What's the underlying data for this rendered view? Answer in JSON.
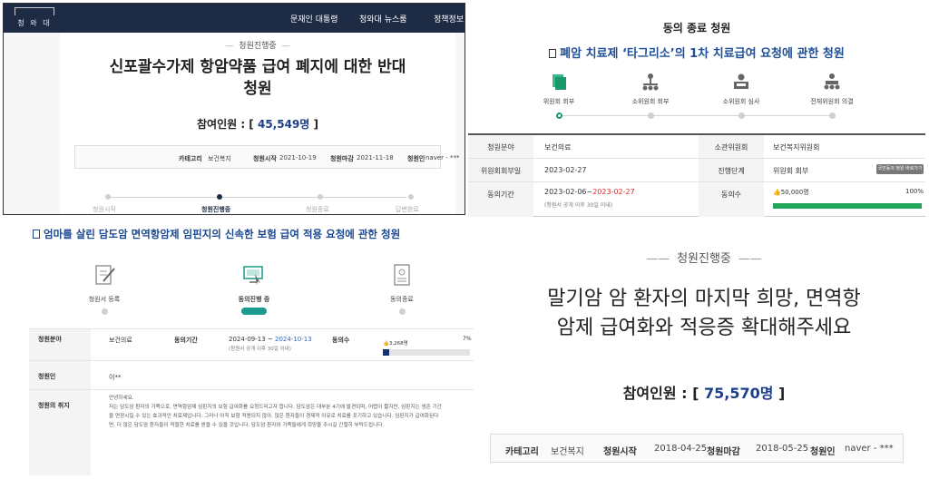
{
  "panel_a": {
    "logo_text": "청 와 대",
    "nav": [
      "문재인 대통령",
      "청와대 뉴스룸",
      "정책정보"
    ],
    "status": "청원진행중",
    "title_line1": "신포괄수가제 항암약품 급여 폐지에 대한 반대",
    "title_line2": "청원",
    "count_label": "참여인원 : [",
    "count_value": "45,549명",
    "count_close": "]",
    "info": {
      "category_label": "카테고리",
      "category_value": "보건복지",
      "start_label": "청원시작",
      "start_value": "2021-10-19",
      "end_label": "청원마감",
      "end_value": "2021-11-18",
      "author_label": "청원인",
      "author_value": "naver - ***"
    },
    "progress": [
      "청원시작",
      "청원진행중",
      "청원종료",
      "답변완료"
    ],
    "progress_active": 1
  },
  "panel_b": {
    "closed_label": "동의 종료 청원",
    "title": "폐암 치료제 ‘타그리소’의 1차 치료급여 요청에 관한 청원",
    "steps": [
      "위원회 회부",
      "소위원회 회부",
      "소위원회 심사",
      "전체위원회 의결"
    ],
    "steps_active": 0,
    "rows": {
      "field_label": "청원분야",
      "field_value": "보건의료",
      "committee_label": "소관위원회",
      "committee_value": "보건복지위원회",
      "refer_date_label": "위원회회부일",
      "refer_date_value": "2023-02-27",
      "stage_label": "진행단계",
      "stage_value": "위원회 회부",
      "more_button": "국민동의 청원 바로가기 >",
      "period_label": "동의기간",
      "period_start": "2023-02-06~",
      "period_end": "2023-02-27",
      "period_note": "(청원서 공개 이후 30일 이내)",
      "agree_label": "동의수",
      "agree_count": "50,000명",
      "agree_percent_label": "100%",
      "agree_fraction": 1.0
    },
    "colors": {
      "title": "#1d4f9a",
      "bar": "#21a55a",
      "deadline": "#d62b2b"
    }
  },
  "panel_c": {
    "title": "엄마를 살린 담도암 면역항암제 임핀지의 신속한 보험 급여 적용 요청에 관한 청원",
    "steps": [
      "청원서 등록",
      "동의진행 중",
      "동의종료"
    ],
    "steps_active": 1,
    "rows": {
      "field_label": "청원분야",
      "field_value": "보건의료",
      "period_label": "동의기간",
      "period_start": "2024-09-13 ~",
      "period_end": "2024-10-13",
      "period_note": "(청원서 공개 이후 30일 이내)",
      "agree_label": "동의수",
      "agree_count": "3,268명",
      "agree_percent_label": "7%",
      "agree_fraction": 0.07,
      "author_label": "청원인",
      "author_value": "이**",
      "purpose_label": "청원의 취지",
      "purpose_lines": [
        "안녕하세요.",
        "저는 담도암 환자의 가족으로, 면역항암제 임핀지의 보험 급여화를 요청드리고자 합니다. 담도암은 대부분 4기에 발견되며, 어렵이 짧지만, 임핀지는 생존 기간",
        "을 연장시킬 수 있는 효과적인 치료제입니다. 그러나 아직 보험 적용되지 않아, 많은 환자들이 경제적 이유로 치료를 포기하고 있습니다. 임핀지가 급여화된다",
        "면, 더 많은 담도암 환자들이 적절한 치료를 받을 수 있을 것입니다. 담도암 환자와 가족들에게 희망을 주시길 간절히 부탁드립니다."
      ]
    },
    "colors": {
      "title": "#1a4790",
      "bar": "#1a2f6e",
      "period_end": "#2f66c4",
      "step_active": "#1a9a8c"
    }
  },
  "panel_d": {
    "status": "청원진행중",
    "title_line1": "말기암 암 환자의 마지막 희망, 면역항",
    "title_line2": "암제 급여화와 적응증 확대해주세요",
    "count_label": "참여인원 : [",
    "count_value": "75,570명",
    "count_close": "]",
    "info": {
      "category_label": "카테고리",
      "category_value": "보건복지",
      "start_label": "청원시작",
      "start_value": "2018-04-25",
      "end_label": "청원마감",
      "end_value": "2018-05-25",
      "author_label": "청원인",
      "author_value": "naver - ***"
    }
  }
}
